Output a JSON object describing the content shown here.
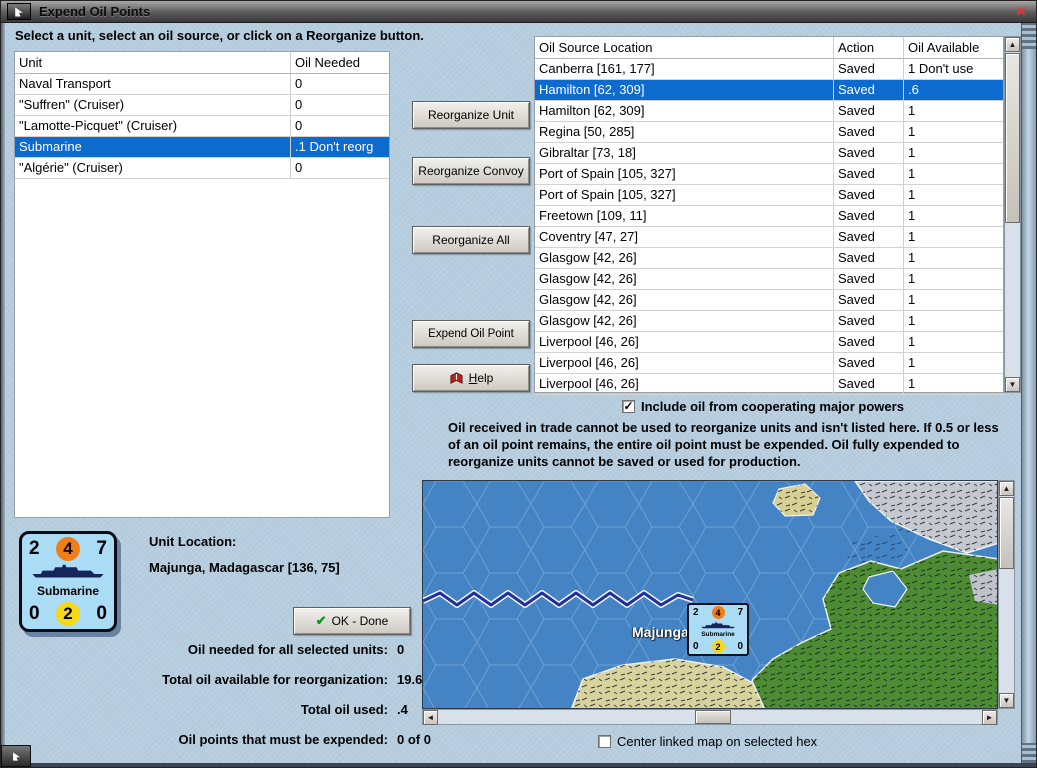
{
  "window": {
    "title": "Expend Oil Points"
  },
  "icons": {
    "up": "▲",
    "down": "▼",
    "left": "◄",
    "right": "►",
    "close": "✕",
    "ok_check": "✔",
    "checkbox_check": "✓"
  },
  "instruction": "Select a unit, select an oil source, or click on a Reorganize button.",
  "unit_table": {
    "columns": {
      "unit": "Unit",
      "oil_needed": "Oil Needed"
    },
    "rows": [
      {
        "unit": "Naval Transport",
        "need": "0",
        "selected": false
      },
      {
        "unit": "\"Suffren\" (Cruiser)",
        "need": "0",
        "selected": false
      },
      {
        "unit": "\"Lamotte-Picquet\" (Cruiser)",
        "need": "0",
        "selected": false
      },
      {
        "unit": "Submarine",
        "need": ".1 Don't reorg",
        "selected": true
      },
      {
        "unit": "\"Algérie\" (Cruiser)",
        "need": "0",
        "selected": false
      }
    ]
  },
  "buttons": {
    "reorganize_unit": "Reorganize Unit",
    "reorganize_convoy": "Reorganize Convoy",
    "reorganize_all": "Reorganize All",
    "expend_oil_point": "Expend Oil Point",
    "help": "Help",
    "ok_done": "OK - Done"
  },
  "oil_table": {
    "columns": {
      "location": "Oil Source Location",
      "action": "Action",
      "available": "Oil Available"
    },
    "rows": [
      {
        "location": "Canberra [161, 177]",
        "action": "Saved",
        "available": "1 Don't use",
        "selected": false
      },
      {
        "location": "Hamilton [62, 309]",
        "action": "Saved",
        "available": ".6",
        "selected": true
      },
      {
        "location": "Hamilton [62, 309]",
        "action": "Saved",
        "available": "1",
        "selected": false
      },
      {
        "location": "Regina [50, 285]",
        "action": "Saved",
        "available": "1",
        "selected": false
      },
      {
        "location": "Gibraltar [73, 18]",
        "action": "Saved",
        "available": "1",
        "selected": false
      },
      {
        "location": "Port of Spain [105, 327]",
        "action": "Saved",
        "available": "1",
        "selected": false
      },
      {
        "location": "Port of Spain [105, 327]",
        "action": "Saved",
        "available": "1",
        "selected": false
      },
      {
        "location": "Freetown [109, 11]",
        "action": "Saved",
        "available": "1",
        "selected": false
      },
      {
        "location": "Coventry [47, 27]",
        "action": "Saved",
        "available": "1",
        "selected": false
      },
      {
        "location": "Glasgow [42, 26]",
        "action": "Saved",
        "available": "1",
        "selected": false
      },
      {
        "location": "Glasgow [42, 26]",
        "action": "Saved",
        "available": "1",
        "selected": false
      },
      {
        "location": "Glasgow [42, 26]",
        "action": "Saved",
        "available": "1",
        "selected": false
      },
      {
        "location": "Glasgow [42, 26]",
        "action": "Saved",
        "available": "1",
        "selected": false
      },
      {
        "location": "Liverpool [46, 26]",
        "action": "Saved",
        "available": "1",
        "selected": false
      },
      {
        "location": "Liverpool [46, 26]",
        "action": "Saved",
        "available": "1",
        "selected": false
      },
      {
        "location": "Liverpool [46, 26]",
        "action": "Saved",
        "available": "1",
        "selected": false
      }
    ]
  },
  "checkboxes": {
    "include_oil": {
      "label": "Include oil from cooperating major powers",
      "checked": true
    },
    "center_map": {
      "label": "Center linked map on selected hex",
      "checked": false
    }
  },
  "note": "Oil received in trade cannot be used to reorganize units and isn't listed here.  If 0.5 or less of an oil point remains, the entire oil point must be expended.   Oil fully expended to reorganize units cannot be saved or used for production.",
  "unit_counter": {
    "top_left": "2",
    "top_center": "4",
    "top_right": "7",
    "name": "Submarine",
    "bottom_left": "0",
    "bottom_center": "2",
    "bottom_right": "0"
  },
  "unit_location": {
    "label": "Unit Location:",
    "value": "Majunga, Madagascar [136, 75]"
  },
  "map": {
    "label": "Majunga",
    "counter": {
      "top_left": "2",
      "top_center": "4",
      "top_right": "7",
      "name": "Submarine",
      "bottom_left": "0",
      "bottom_center": "2",
      "bottom_right": "0"
    }
  },
  "stats": [
    {
      "label": "Oil needed for all selected units:",
      "value": "0"
    },
    {
      "label": "Total oil available for reorganization:",
      "value": "19.6"
    },
    {
      "label": "Total oil used:",
      "value": ".4"
    },
    {
      "label": "Oil points that must be expended:",
      "value": "0 of 0"
    }
  ],
  "colors": {
    "selection_blue": "#0d6bd0",
    "window_background": "#b7cedf",
    "sea_blue": "#4584c4",
    "land_green": "#4e8c33",
    "land_tan": "#d8d29c",
    "counter_blue": "#aadcf6",
    "circle_orange": "#f07d18",
    "circle_yellow": "#f5d816"
  }
}
